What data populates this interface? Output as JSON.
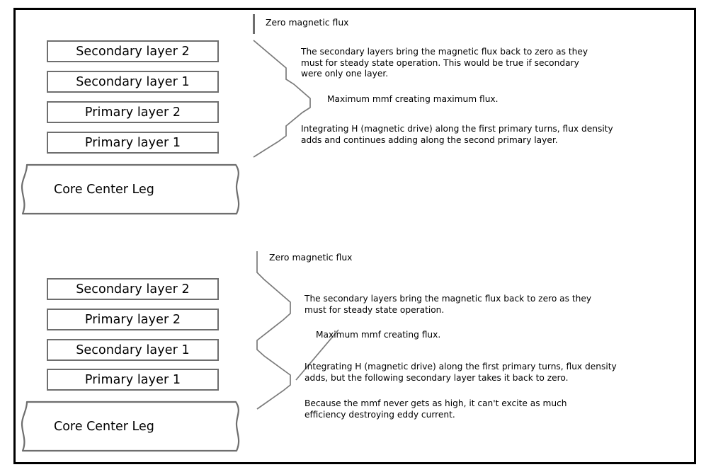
{
  "figure": {
    "title": "Transformer winding interleaving and magnetic flux diagram",
    "border_color": "#000000",
    "box_border_color": "#6e6e6e",
    "flux_line_color": "#7a7a7a"
  },
  "top_section": {
    "layers": [
      {
        "label": "Secondary layer 2"
      },
      {
        "label": "Secondary layer 1"
      },
      {
        "label": "Primary layer 2"
      },
      {
        "label": "Primary layer 1"
      }
    ],
    "core": {
      "label": "Core Center Leg"
    },
    "annotations": [
      {
        "text": "Zero magnetic flux"
      },
      {
        "text": "The secondary layers bring the magnetic flux back to zero as they\nmust for steady state operation. This would be true if secondary\nwere only one layer."
      },
      {
        "text": "Maximum mmf creating maximum flux."
      },
      {
        "text": "Integrating H (magnetic drive) along the first primary turns, flux density\nadds and continues adding along the second primary layer."
      }
    ]
  },
  "bottom_section": {
    "layers": [
      {
        "label": "Secondary layer 2"
      },
      {
        "label": "Primary layer 2"
      },
      {
        "label": "Secondary layer 1"
      },
      {
        "label": "Primary layer 1"
      }
    ],
    "core": {
      "label": "Core Center Leg"
    },
    "annotations": [
      {
        "text": "Zero magnetic flux"
      },
      {
        "text": "The secondary layers bring the magnetic flux back to zero as they\nmust for steady state operation."
      },
      {
        "text": "Maximum mmf creating flux."
      },
      {
        "text": "Integrating H (magnetic drive) along the first primary turns, flux density\nadds, but the following secondary layer takes it back to zero."
      },
      {
        "text": "Because the mmf never gets as high, it can't excite as much\nefficiency destroying eddy current."
      }
    ]
  }
}
